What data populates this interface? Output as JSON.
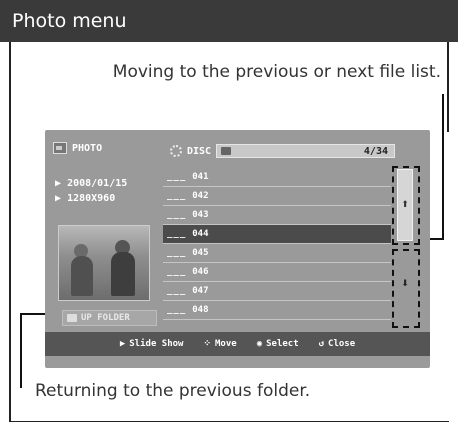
{
  "header": {
    "title": "Photo menu"
  },
  "captions": {
    "top": "Moving to the previous or next file list.",
    "bottom": "Returning to the previous folder."
  },
  "screen": {
    "section_label": "PHOTO",
    "date": "2008/01/15",
    "resolution": "1280X960",
    "up_folder_label": "UP FOLDER",
    "disc_label": "DISC",
    "file_count": "4/34",
    "files": [
      {
        "dash": "___",
        "name": "041"
      },
      {
        "dash": "___",
        "name": "042"
      },
      {
        "dash": "___",
        "name": "043"
      },
      {
        "dash": "___",
        "name": "044"
      },
      {
        "dash": "___",
        "name": "045"
      },
      {
        "dash": "___",
        "name": "046"
      },
      {
        "dash": "___",
        "name": "047"
      },
      {
        "dash": "___",
        "name": "048"
      }
    ],
    "selected_file": "044",
    "icons": {
      "play": "▶",
      "move": "⁘",
      "select": "◉",
      "close": "↺",
      "up": "⬆",
      "down": "⬇"
    },
    "bottom_bar": {
      "slideshow": "Slide Show",
      "move": "Move",
      "select": "Select",
      "close": "Close"
    }
  },
  "colors": {
    "header_bg": "#3a3a3a",
    "screen_bg": "#9a9a9a",
    "selected_row": "#4b4b4b"
  }
}
